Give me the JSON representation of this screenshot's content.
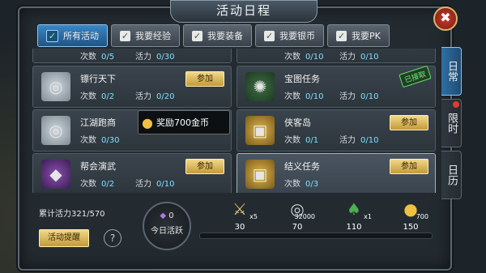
{
  "header": {
    "title": "活动日程",
    "close_label": "✖"
  },
  "tabs": [
    {
      "label": "所有活动",
      "active": true
    },
    {
      "label": "我要经验",
      "active": false
    },
    {
      "label": "我要装备",
      "active": false
    },
    {
      "label": "我要银币",
      "active": false
    },
    {
      "label": "我要PK",
      "active": false
    }
  ],
  "side_tabs": [
    {
      "label": "日常",
      "active": true
    },
    {
      "label": "限时",
      "active": false
    },
    {
      "label": "日历",
      "active": false
    }
  ],
  "labels": {
    "count": "次数",
    "vitality": "活力"
  },
  "top_partial": [
    {
      "count": "0/5",
      "vitality": "0/30"
    },
    {
      "count": "0/10",
      "vitality": "0/10"
    }
  ],
  "activities": [
    {
      "name": "镖行天下",
      "count": "0/2",
      "vitality": "0/20",
      "button": "参加",
      "icon": "silver-coins-icon"
    },
    {
      "name": "宝图任务",
      "count": "0/10",
      "vitality": "0/10",
      "badge": "已接取",
      "icon": "treasure-map-icon"
    },
    {
      "name": "江湖跑商",
      "count": "0/30",
      "vitality": "",
      "icon": "silver-coins-icon"
    },
    {
      "name": "侠客岛",
      "count": "0/1",
      "vitality": "0/10",
      "button": "参加",
      "icon": "treasure-chest-icon"
    },
    {
      "name": "帮会演武",
      "count": "0/2",
      "vitality": "0/10",
      "button": "参加",
      "icon": "crystal-icon"
    },
    {
      "name": "结义任务",
      "count": "0/3",
      "vitality": "",
      "button": "参加",
      "icon": "treasure-chest-icon",
      "selected": true
    }
  ],
  "tooltip": {
    "text": "奖励700金币"
  },
  "bottom": {
    "accumulated": "累计活力321/570",
    "remind_label": "活动提醒",
    "help_label": "?",
    "today_value": "0",
    "today_label": "今日活跃",
    "progress": 0.0,
    "milestones": [
      {
        "mark": "30",
        "count": "x5",
        "icon": "sword-icon"
      },
      {
        "mark": "70",
        "count": "32000",
        "icon": "silver-coins-icon"
      },
      {
        "mark": "110",
        "count": "x1",
        "icon": "money-bag-icon"
      },
      {
        "mark": "150",
        "count": "700",
        "icon": "gold-coins-icon"
      }
    ]
  },
  "colors": {
    "accent": "#3b86c4",
    "gold": "#c59a3a",
    "progress": "#3fa0d8"
  }
}
